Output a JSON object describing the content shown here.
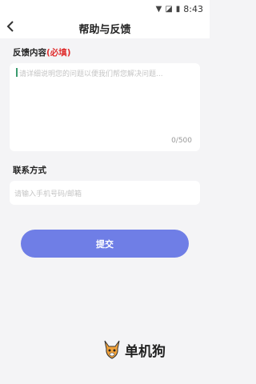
{
  "status_bar": {
    "time": "8:43",
    "icons": [
      "wifi-icon",
      "sim-icon",
      "battery-icon"
    ]
  },
  "header": {
    "title": "帮助与反馈",
    "back_icon": "chevron-left-icon"
  },
  "feedback": {
    "label": "反馈内容",
    "required": "(必填)",
    "placeholder": "请详细说明您的问题以便我们帮您解决问题...",
    "counter": "0/500"
  },
  "contact": {
    "label": "联系方式",
    "placeholder": "请输入手机号码/邮箱"
  },
  "submit_label": "提交",
  "watermark": {
    "text": "单机狗",
    "icon": "dog-mascot-icon"
  },
  "colors": {
    "accent": "#6f7ee6",
    "required": "#e03030",
    "background": "#f4f4f6"
  }
}
